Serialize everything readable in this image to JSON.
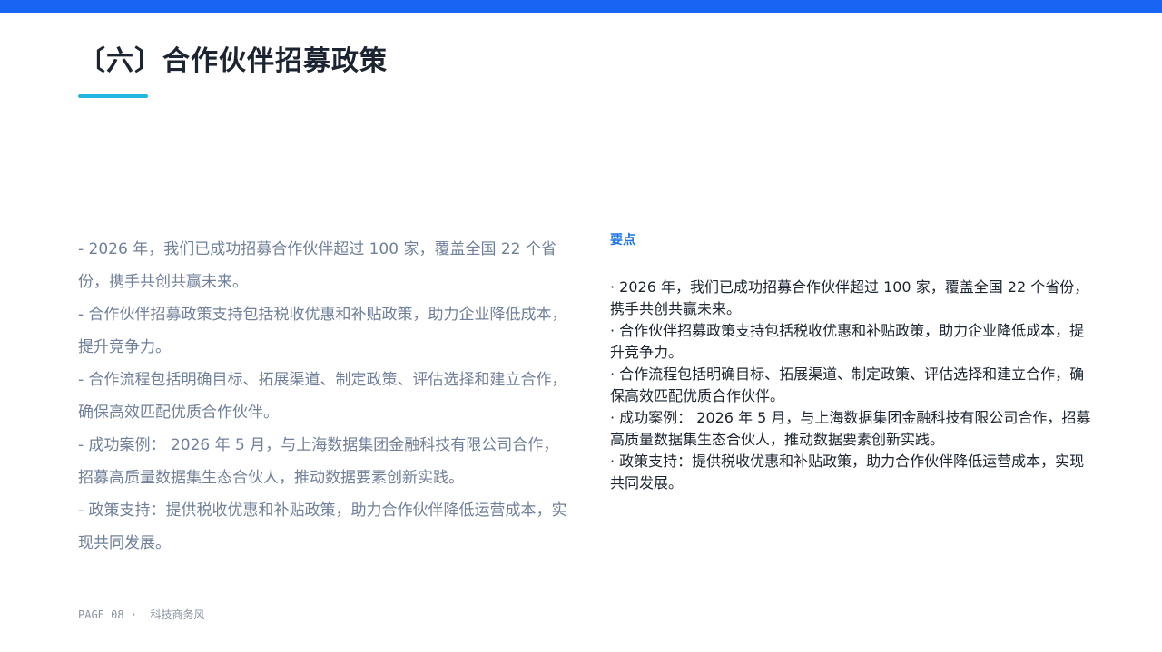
{
  "slide": {
    "title": "〔六〕合作伙伴招募政策",
    "accent_color": "#1765f2",
    "underline_color": "#21b7e0",
    "left_items": [
      "- 2026 年，我们已成功招募合作伙伴超过 100 家，覆盖全国 22 个省份，携手共创共赢未来。",
      "-  合作伙伴招募政策支持包括税收优惠和补贴政策，助力企业降低成本，提升竞争力。",
      "-  合作流程包括明确目标、拓展渠道、制定政策、评估选择和建立合作，确保高效匹配优质合作伙伴。",
      "-  成功案例： 2026 年 5 月，与上海数据集团金融科技有限公司合作，招募高质量数据集生态合伙人，推动数据要素创新实践。",
      "-  政策支持：提供税收优惠和补贴政策，助力合作伙伴降低运营成本，实现共同发展。"
    ],
    "callout": {
      "heading": "要点",
      "heading_color": "#1a73e8",
      "items": [
        "· 2026 年，我们已成功招募合作伙伴超过 100 家，覆盖全国 22 个省份，携手共创共赢未来。",
        "·  合作伙伴招募政策支持包括税收优惠和补贴政策，助力企业降低成本，提升竞争力。",
        "·  合作流程包括明确目标、拓展渠道、制定政策、评估选择和建立合作，确保高效匹配优质合作伙伴。",
        "·  成功案例： 2026 年 5 月，与上海数据集团金融科技有限公司合作，招募高质量数据集生态合伙人，推动数据要素创新实践。",
        "·  政策支持：提供税收优惠和补贴政策，助力合作伙伴降低运营成本，实现共同发展。"
      ]
    },
    "footer": {
      "page_label": "PAGE 08",
      "separator": "·",
      "theme": "科技商务风"
    }
  }
}
